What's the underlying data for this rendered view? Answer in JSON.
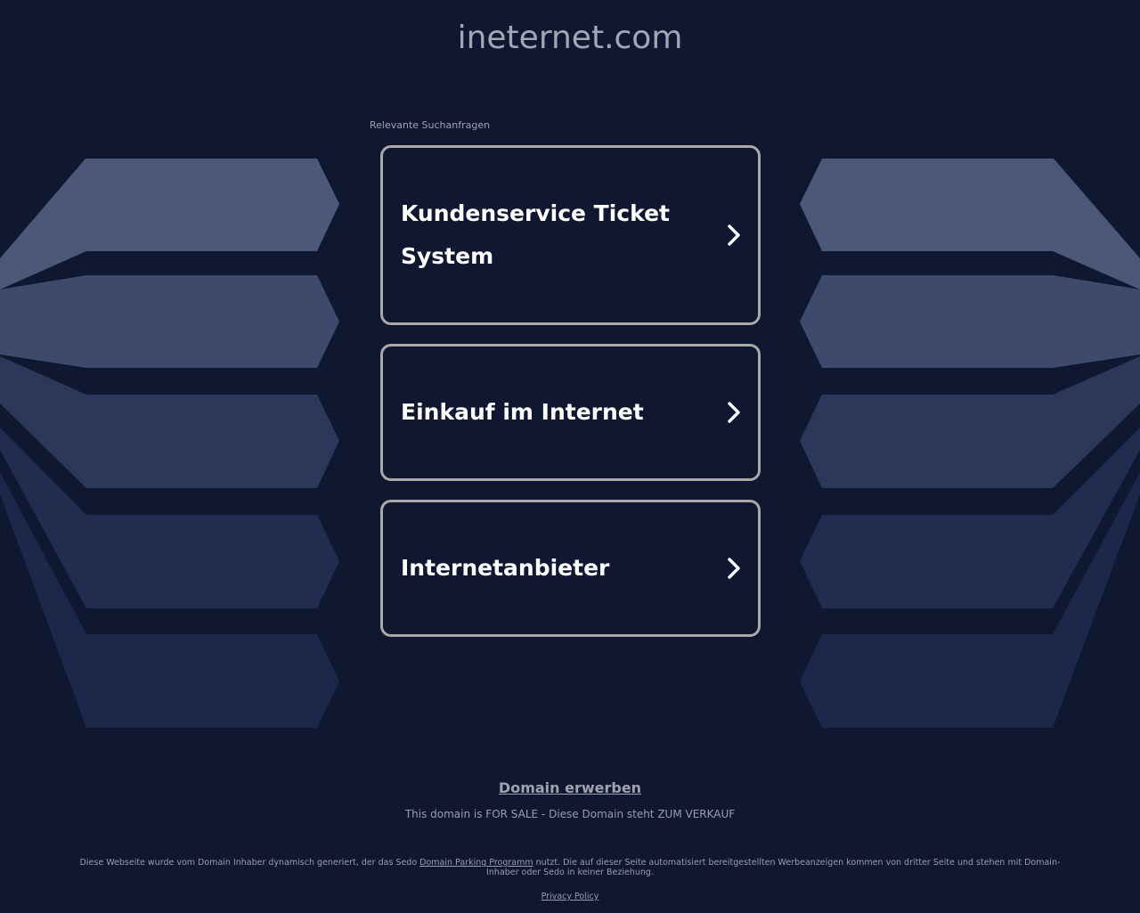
{
  "site": {
    "title": "ineternet.com"
  },
  "related": {
    "label": "Relevante Suchanfragen",
    "items": [
      {
        "label": "Kundenservice Ticket System"
      },
      {
        "label": "Einkauf im Internet"
      },
      {
        "label": "Internetanbieter"
      }
    ]
  },
  "footer": {
    "buy_label": "Domain erwerben",
    "sale_text": "This domain is FOR SALE - Diese Domain steht ZUM VERKAUF",
    "disclaimer_before": "Diese Webseite wurde vom Domain Inhaber dynamisch generiert, der das Sedo ",
    "disclaimer_link": "Domain Parking Programm",
    "disclaimer_after": " nutzt. Die auf dieser Seite automatisiert bereitgestellten Werbeanzeigen kommen von dritter Seite und stehen mit Domain-Inhaber oder Sedo in keiner Beziehung.",
    "privacy_label": "Privacy Policy"
  },
  "colors": {
    "background": "#101731",
    "card_border": "#a9a9aa",
    "card_text": "#ffffff",
    "muted_text": "#9a9eaa",
    "deco_band_1": "#4c5878",
    "deco_band_2": "#3e4a6c",
    "deco_band_3": "#2c3859",
    "deco_band_4": "#212c4e",
    "deco_band_5": "#1d2749"
  },
  "icons": {
    "card_arrow": "chevron-right-icon"
  }
}
